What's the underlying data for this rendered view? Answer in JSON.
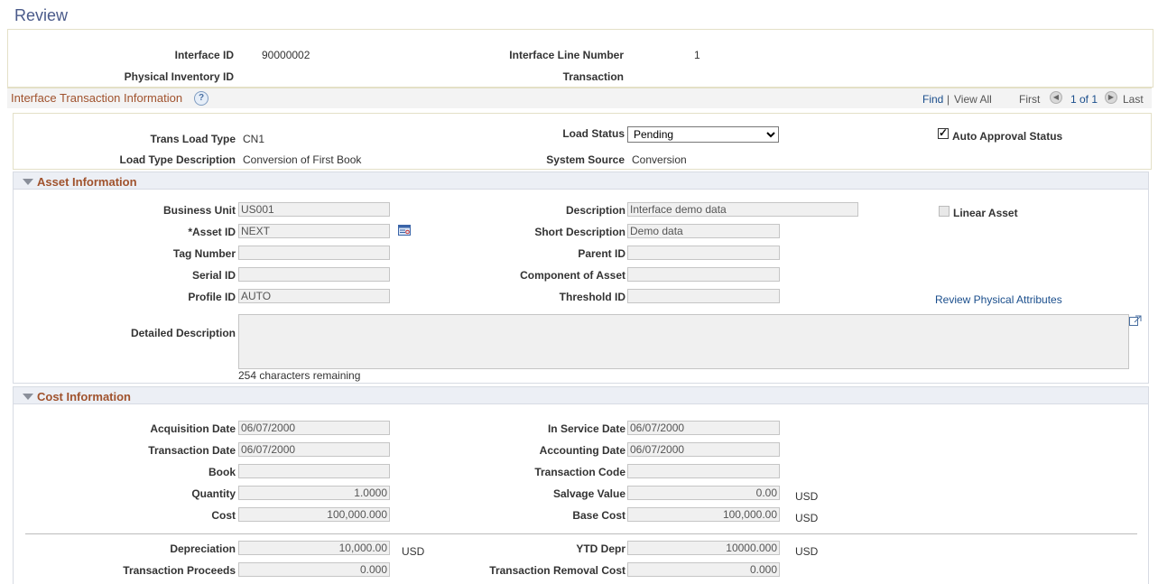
{
  "page": {
    "title": "Review"
  },
  "header": {
    "interface_id_label": "Interface ID",
    "interface_id_value": "90000002",
    "interface_line_label": "Interface Line Number",
    "interface_line_value": "1",
    "physical_inventory_label": "Physical Inventory ID",
    "transaction_label": "Transaction"
  },
  "grid": {
    "title": "Interface Transaction Information",
    "help": "?",
    "find": "Find",
    "separator": "|",
    "view_all": "View All",
    "first": "First",
    "page_info": "1 of 1",
    "last": "Last"
  },
  "trans": {
    "trans_load_type_label": "Trans Load Type",
    "trans_load_type_value": "CN1",
    "load_status_label": "Load Status",
    "load_status_value": "Pending",
    "auto_approval_label": "Auto Approval Status",
    "auto_approval_checked": true,
    "load_type_desc_label": "Load Type Description",
    "load_type_desc_value": "Conversion of First Book",
    "system_source_label": "System Source",
    "system_source_value": "Conversion"
  },
  "asset": {
    "section_title": "Asset Information",
    "business_unit_label": "Business Unit",
    "business_unit_value": "US001",
    "asset_id_label": "*Asset ID",
    "asset_id_value": "NEXT",
    "tag_number_label": "Tag Number",
    "tag_number_value": "",
    "serial_id_label": "Serial ID",
    "serial_id_value": "",
    "profile_id_label": "Profile ID",
    "profile_id_value": "AUTO",
    "description_label": "Description",
    "description_value": "Interface demo data",
    "short_desc_label": "Short Description",
    "short_desc_value": "Demo data",
    "parent_id_label": "Parent ID",
    "parent_id_value": "",
    "component_label": "Component of Asset",
    "component_value": "",
    "threshold_label": "Threshold ID",
    "threshold_value": "",
    "linear_asset_label": "Linear Asset",
    "review_physical_link": "Review Physical Attributes",
    "detailed_desc_label": "Detailed Description",
    "detailed_desc_value": "",
    "chars_remaining": "254 characters remaining"
  },
  "cost": {
    "section_title": "Cost Information",
    "acquisition_date_label": "Acquisition Date",
    "acquisition_date_value": "06/07/2000",
    "transaction_date_label": "Transaction Date",
    "transaction_date_value": "06/07/2000",
    "book_label": "Book",
    "book_value": "",
    "quantity_label": "Quantity",
    "quantity_value": "1.0000",
    "cost_label": "Cost",
    "cost_value": "100,000.000",
    "in_service_date_label": "In Service Date",
    "in_service_date_value": "06/07/2000",
    "accounting_date_label": "Accounting Date",
    "accounting_date_value": "06/07/2000",
    "transaction_code_label": "Transaction Code",
    "transaction_code_value": "",
    "salvage_value_label": "Salvage Value",
    "salvage_value_value": "0.00",
    "salvage_currency": "USD",
    "base_cost_label": "Base Cost",
    "base_cost_value": "100,000.00",
    "base_cost_currency": "USD",
    "depreciation_label": "Depreciation",
    "depreciation_value": "10,000.00",
    "depreciation_currency": "USD",
    "ytd_depr_label": "YTD Depr",
    "ytd_depr_value": "10000.000",
    "ytd_depr_currency": "USD",
    "proceeds_label": "Transaction Proceeds",
    "proceeds_value": "0.000",
    "removal_cost_label": "Transaction Removal Cost",
    "removal_cost_value": "0.000"
  }
}
